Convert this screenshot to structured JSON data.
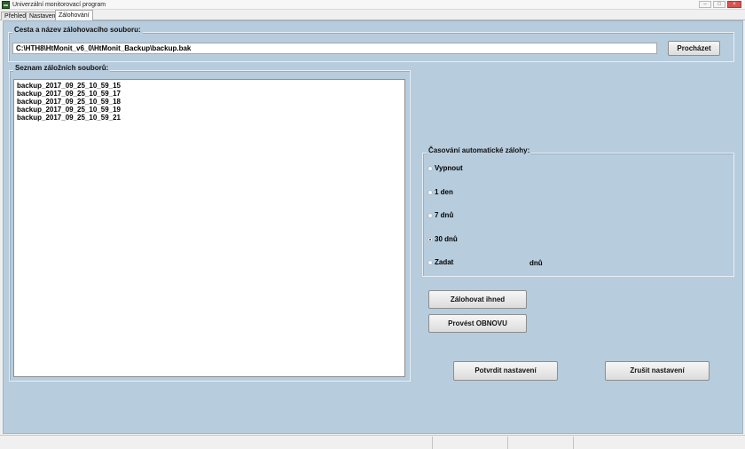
{
  "window": {
    "title": "Univerzální monitorovací program",
    "buttons": {
      "minimize": "–",
      "maximize": "□",
      "close": "×"
    }
  },
  "tabs": [
    {
      "label": "Přehled",
      "active": false
    },
    {
      "label": "Nastavení",
      "active": false
    },
    {
      "label": "Zálohování",
      "active": true
    }
  ],
  "backup_path": {
    "group_title": "Cesta a název zálohovacího souboru:",
    "value": "C:\\HTH8\\HtMonit_v6_0\\HtMonit_Backup\\backup.bak",
    "browse_label": "Procházet"
  },
  "backup_list": {
    "group_title": "Seznam záložních souborů:",
    "items": [
      "backup_2017_09_25_10_59_15",
      "backup_2017_09_25_10_59_17",
      "backup_2017_09_25_10_59_18",
      "backup_2017_09_25_10_59_19",
      "backup_2017_09_25_10_59_21"
    ]
  },
  "schedule": {
    "group_title": "Časování automatické zálohy:",
    "options": [
      {
        "label": "Vypnout",
        "checked": false
      },
      {
        "label": "1 den",
        "checked": false
      },
      {
        "label": "7 dnů",
        "checked": false
      },
      {
        "label": "30 dnů",
        "checked": true
      },
      {
        "label": "Zadat",
        "checked": false
      }
    ],
    "custom_unit": "dnů"
  },
  "actions": {
    "backup_now": "Zálohovat ihned",
    "restore": "Provést OBNOVU",
    "confirm": "Potvrdit nastavení",
    "cancel": "Zrušit nastavení"
  },
  "colors": {
    "panel_background": "#b7ccdd",
    "window_background": "#f0f0f0",
    "close_button": "#d9534f"
  }
}
